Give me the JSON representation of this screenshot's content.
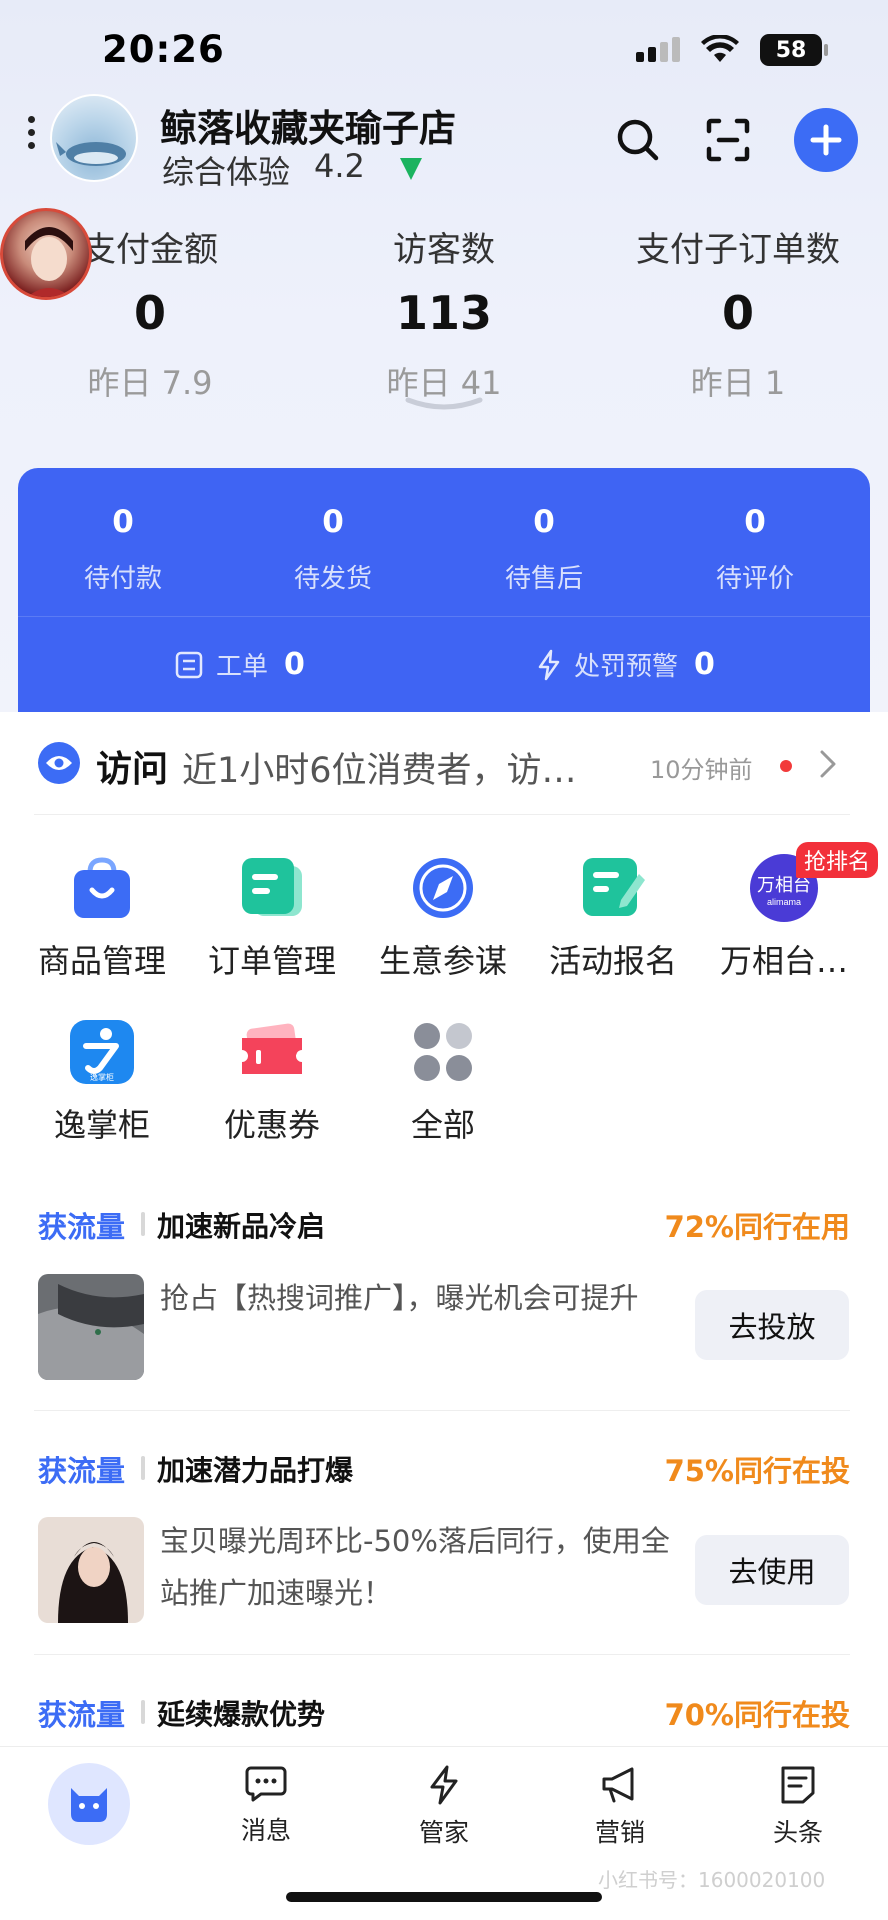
{
  "status_bar": {
    "time": "20:26",
    "battery": "58"
  },
  "header": {
    "shop_name": "鲸落收藏夹瑜子店",
    "experience_label": "综合体验",
    "experience_score": "4.2"
  },
  "stats": [
    {
      "label": "支付金额",
      "value": "0",
      "yesterday": "昨日 7.9"
    },
    {
      "label": "访客数",
      "value": "113",
      "yesterday": "昨日 41"
    },
    {
      "label": "支付子订单数",
      "value": "0",
      "yesterday": "昨日 1"
    }
  ],
  "orders": [
    {
      "label": "待付款",
      "count": "0"
    },
    {
      "label": "待发货",
      "count": "0"
    },
    {
      "label": "待售后",
      "count": "0"
    },
    {
      "label": "待评价",
      "count": "0"
    }
  ],
  "tickets": {
    "work_order": {
      "label": "工单",
      "count": "0"
    },
    "penalty": {
      "label": "处罚预警",
      "count": "0"
    }
  },
  "visit": {
    "title": "访问",
    "text": "近1小时6位消费者，访…",
    "time": "10分钟前"
  },
  "apps": [
    {
      "name": "商品管理",
      "icon": "shopping-bag-icon"
    },
    {
      "name": "订单管理",
      "icon": "order-list-icon"
    },
    {
      "name": "生意参谋",
      "icon": "compass-icon"
    },
    {
      "name": "活动报名",
      "icon": "signup-icon"
    },
    {
      "name": "万相台…",
      "icon": "wanxiangtai-icon",
      "badge": "抢排名"
    },
    {
      "name": "逸掌柜",
      "icon": "yizhanggui-icon"
    },
    {
      "name": "优惠券",
      "icon": "coupon-icon"
    },
    {
      "name": "全部",
      "icon": "grid-icon"
    }
  ],
  "app_icon_text": {
    "wanxiangtai": "万相台",
    "wanxiangtai_sub": "alimama",
    "yizhanggui_sub": "逸掌柜"
  },
  "traffic_cards": [
    {
      "tag": "获流量",
      "title": "加速新品冷启",
      "percent": "72%同行在用",
      "desc": "抢占【热搜词推广】，曝光机会可提升",
      "button": "去投放"
    },
    {
      "tag": "获流量",
      "title": "加速潜力品打爆",
      "percent": "75%同行在投",
      "desc": "宝贝曝光周环比-50%落后同行，使用全站推广加速曝光！",
      "button": "去使用"
    },
    {
      "tag": "获流量",
      "title": "延续爆款优势",
      "percent": "70%同行在投"
    }
  ],
  "bottom_nav": [
    {
      "label": "消息",
      "icon": "message-icon"
    },
    {
      "label": "管家",
      "icon": "lightning-icon"
    },
    {
      "label": "营销",
      "icon": "megaphone-icon"
    },
    {
      "label": "头条",
      "icon": "news-icon"
    }
  ],
  "watermark": "小红书号：1600020100",
  "colors": {
    "primary": "#3c6cf5",
    "orange": "#f08a1c",
    "red": "#f2303a",
    "green": "#1bb35f"
  }
}
